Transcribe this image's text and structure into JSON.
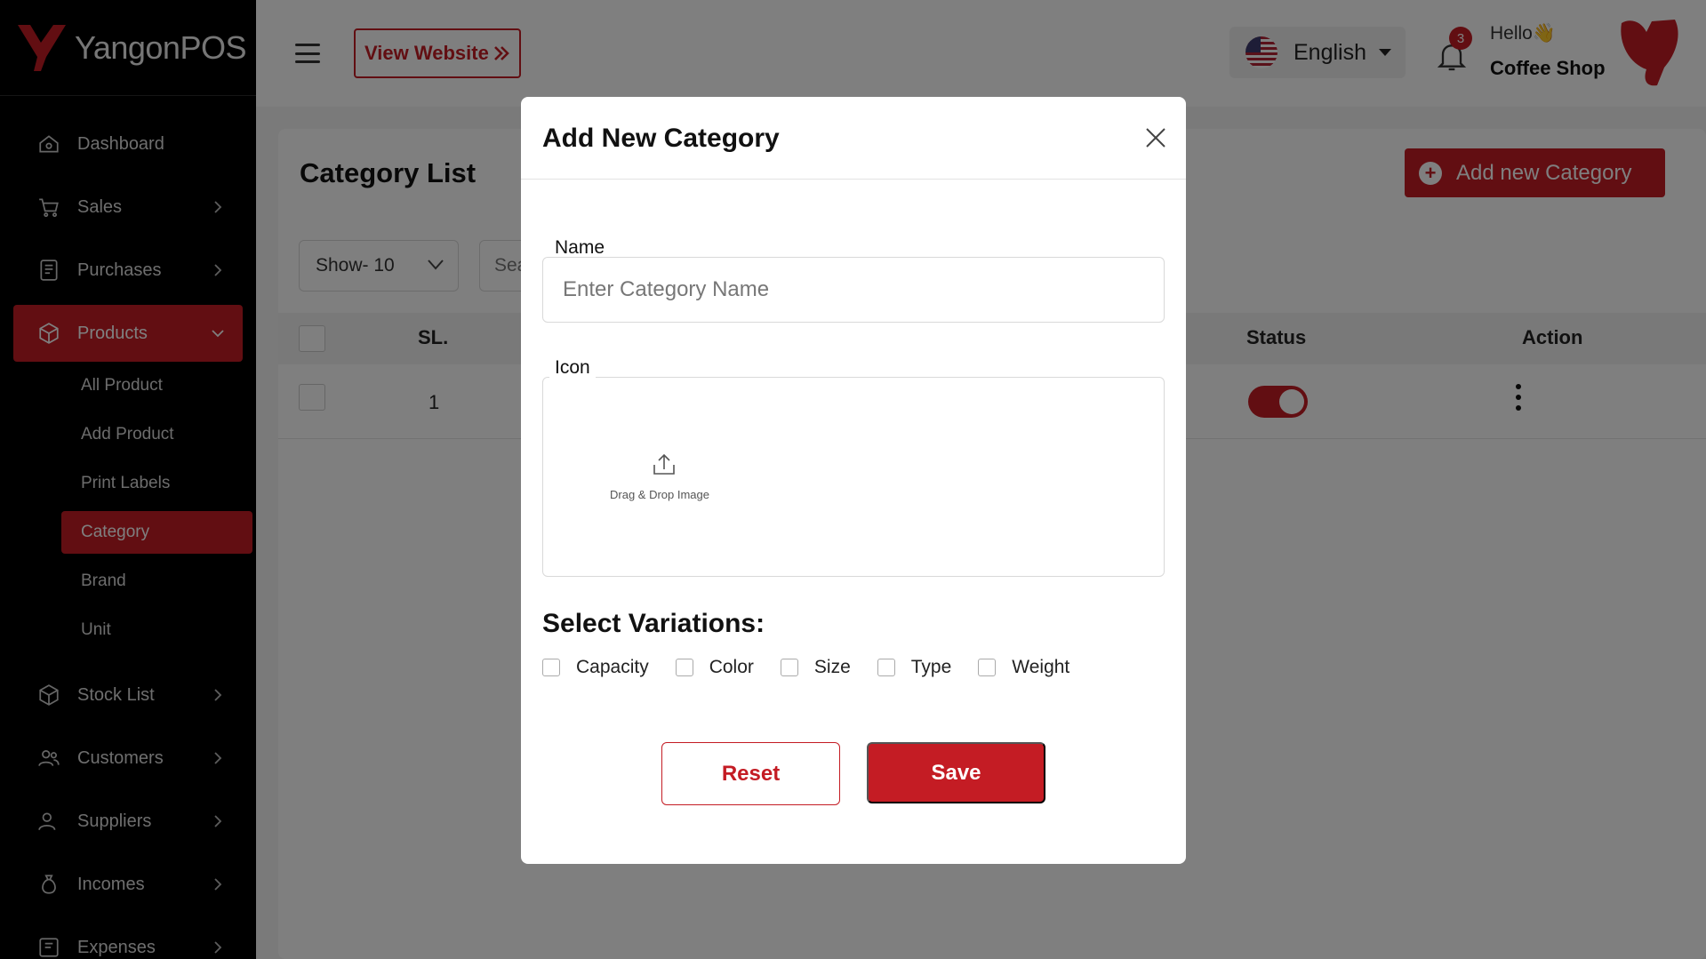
{
  "app": {
    "name": "YangonPOS"
  },
  "sidebar": {
    "items": [
      {
        "label": "Dashboard",
        "icon": "home-icon"
      },
      {
        "label": "Sales",
        "icon": "cart-icon"
      },
      {
        "label": "Purchases",
        "icon": "receipt-icon"
      },
      {
        "label": "Products",
        "icon": "box-icon"
      },
      {
        "label": "Stock List",
        "icon": "box-icon"
      },
      {
        "label": "Customers",
        "icon": "users-icon"
      },
      {
        "label": "Suppliers",
        "icon": "user-icon"
      },
      {
        "label": "Incomes",
        "icon": "money-bag-icon"
      },
      {
        "label": "Expenses",
        "icon": "expense-icon"
      }
    ],
    "products_sub": [
      {
        "label": "All Product"
      },
      {
        "label": "Add Product"
      },
      {
        "label": "Print Labels"
      },
      {
        "label": "Category"
      },
      {
        "label": "Brand"
      },
      {
        "label": "Unit"
      }
    ]
  },
  "topbar": {
    "view_website": "View Website",
    "language": "English",
    "notification_count": "3",
    "greeting": "Hello👋",
    "shop_name": "Coffee Shop"
  },
  "page": {
    "title": "Category List",
    "add_button": "Add new Category",
    "show_select": "Show- 10",
    "search_placeholder": "Search",
    "table": {
      "headers": {
        "sl": "SL.",
        "status": "Status",
        "action": "Action"
      },
      "rows": [
        {
          "sl": "1",
          "status_on": true
        }
      ]
    }
  },
  "modal": {
    "title": "Add New Category",
    "name_label": "Name",
    "name_placeholder": "Enter Category Name",
    "icon_label": "Icon",
    "drop_text": "Drag & Drop Image",
    "variations_title": "Select Variations:",
    "variations": [
      "Capacity",
      "Color",
      "Size",
      "Type",
      "Weight"
    ],
    "reset_label": "Reset",
    "save_label": "Save"
  },
  "colors": {
    "accent": "#c41c24",
    "sidebar_bg": "#000000",
    "overlay": "rgba(0,0,0,0.5)"
  }
}
